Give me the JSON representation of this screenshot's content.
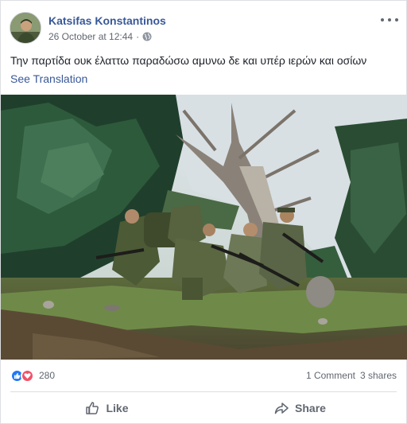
{
  "post": {
    "author": "Katsifas Konstantinos",
    "timestamp": "26 October at 12:44",
    "separator": "·",
    "privacy_icon": "globe-icon",
    "text": "Την παρτίδα ουκ έλαττω παραδώσω αμυνω δε και υπέρ ιερών και οσίων",
    "see_translation": "See Translation"
  },
  "reactions": {
    "icons": [
      "like-icon",
      "love-icon"
    ],
    "count": "280",
    "comments": "1 Comment",
    "shares": "3 shares"
  },
  "actions": {
    "like_label": "Like",
    "share_label": "Share"
  },
  "colors": {
    "author_link": "#385898",
    "like_blue": "#2078f4",
    "love_red": "#f25268",
    "muted_text": "#606770"
  }
}
